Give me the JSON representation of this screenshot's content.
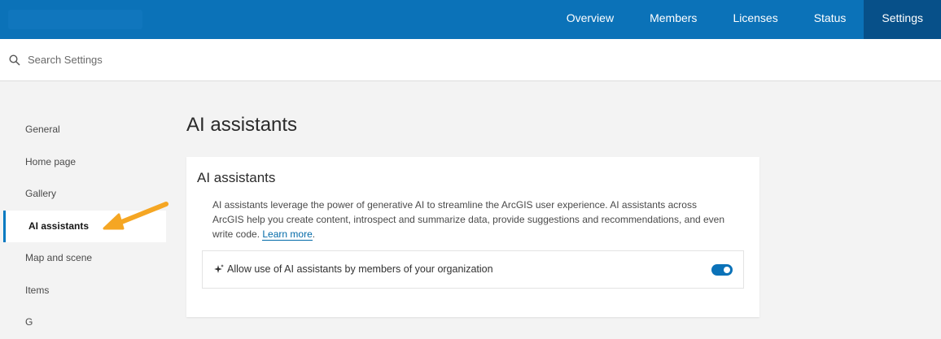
{
  "header": {
    "nav": [
      {
        "label": "Overview",
        "active": false
      },
      {
        "label": "Members",
        "active": false
      },
      {
        "label": "Licenses",
        "active": false
      },
      {
        "label": "Status",
        "active": false
      },
      {
        "label": "Settings",
        "active": true
      }
    ],
    "accent_color": "#0b72b8"
  },
  "search": {
    "placeholder": "Search Settings",
    "icon": "search-icon"
  },
  "sidebar": {
    "items": [
      {
        "label": "General",
        "active": false
      },
      {
        "label": "Home page",
        "active": false
      },
      {
        "label": "Gallery",
        "active": false
      },
      {
        "label": "AI assistants",
        "active": true
      },
      {
        "label": "Map and scene",
        "active": false
      },
      {
        "label": "Items",
        "active": false
      },
      {
        "label": "G",
        "active": false
      }
    ]
  },
  "main": {
    "title": "AI assistants",
    "card": {
      "title": "AI assistants",
      "description": "AI assistants leverage the power of generative AI to streamline the ArcGIS user experience. AI assistants across ArcGIS help you create content, introspect and summarize data, provide suggestions and recommendations, and even write code.",
      "learn_more": "Learn more",
      "period": ".",
      "toggle": {
        "icon": "sparkle-icon",
        "label": "Allow use of AI assistants by members of your organization",
        "enabled": true
      }
    }
  },
  "annotation": {
    "icon": "arrow-icon",
    "color": "#f5a623"
  }
}
